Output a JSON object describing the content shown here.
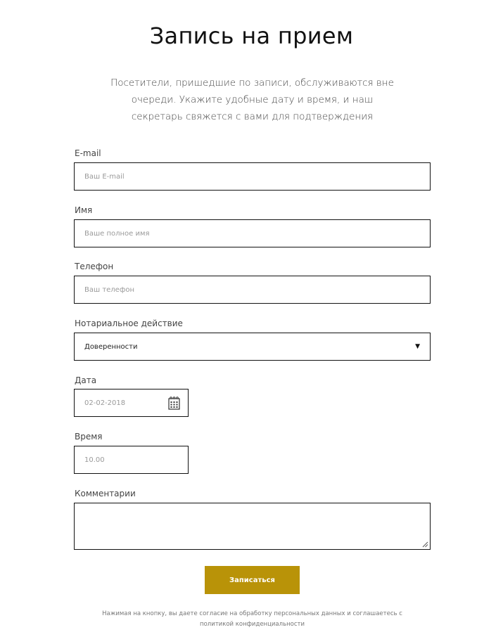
{
  "header": {
    "title": "Запись на прием",
    "subtitle": "Посетители, пришедшие по записи, обслуживаются вне очереди. Укажите удобные дату и время, и наш секретарь свяжется с вами для подтверждения"
  },
  "form": {
    "email": {
      "label": "E-mail",
      "placeholder": "Ваш E-mail"
    },
    "name": {
      "label": "Имя",
      "placeholder": "Ваше полное имя"
    },
    "phone": {
      "label": "Телефон",
      "placeholder": "Ваш телефон"
    },
    "action": {
      "label": "Нотариальное действие",
      "value": "Доверенности"
    },
    "date": {
      "label": "Дата",
      "placeholder": "02-02-2018"
    },
    "time": {
      "label": "Время",
      "placeholder": "10.00"
    },
    "comments": {
      "label": "Комментарии",
      "value": ""
    },
    "submit_label": "Записаться",
    "consent_text": "Нажимая на кнопку, вы даете согласие на обработку персональных данных и соглашаетесь с политикой конфиденциальности"
  },
  "icons": {
    "select_caret": "chevron-down-icon",
    "date_picker": "calendar-icon",
    "textarea_resize": "resize-grip-icon"
  },
  "colors": {
    "accent": "#b99308",
    "border": "#111111",
    "placeholder": "#9a9a9a"
  }
}
